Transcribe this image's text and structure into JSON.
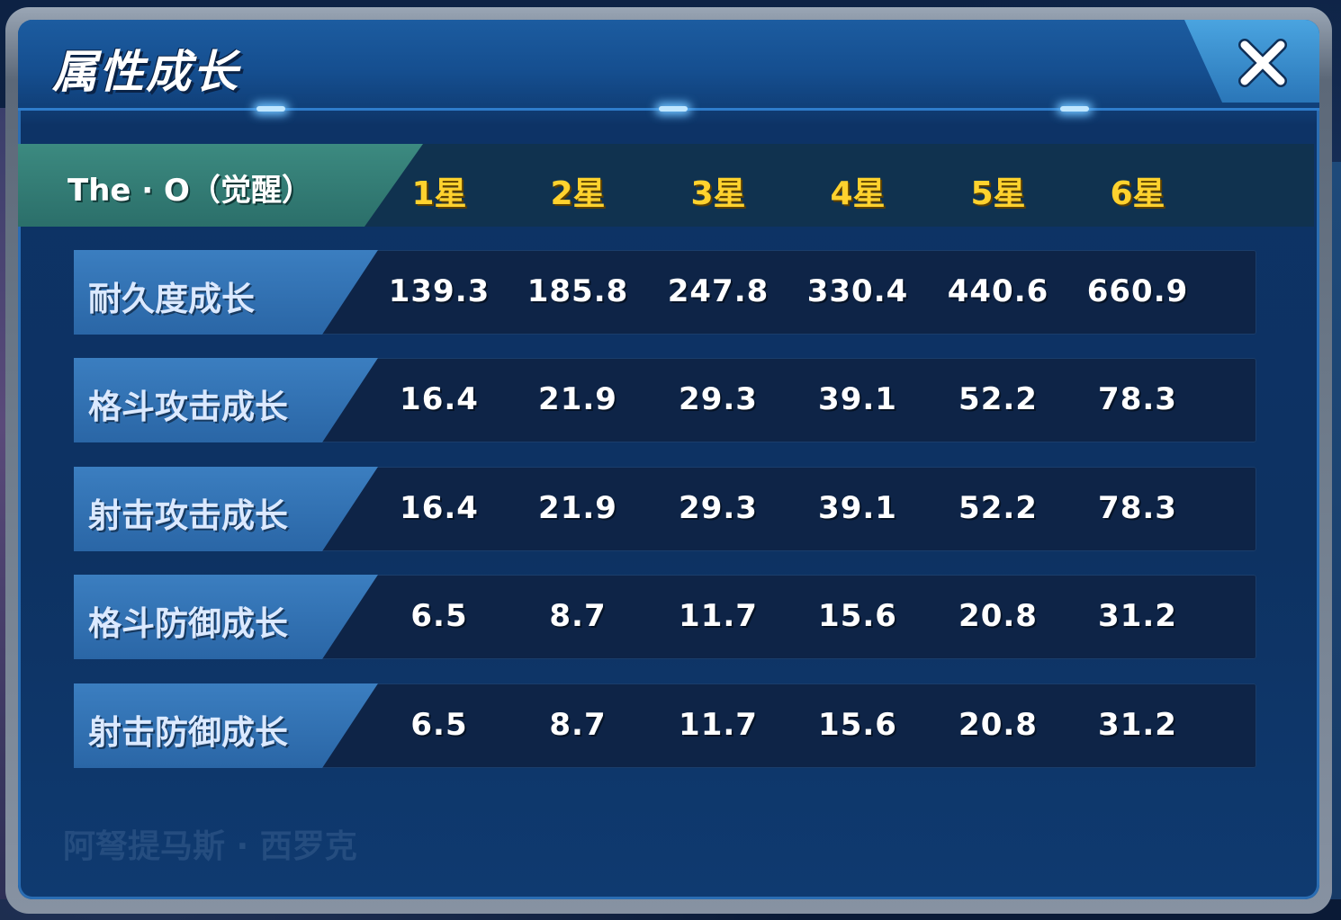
{
  "dialog": {
    "title": "属性成长",
    "close_label": "✕"
  },
  "table": {
    "unit_name": "The · O（觉醒）",
    "star_columns": [
      "1星",
      "2星",
      "3星",
      "4星",
      "5星",
      "6星"
    ],
    "rows": [
      {
        "label": "耐久度成长",
        "values": [
          "139.3",
          "185.8",
          "247.8",
          "330.4",
          "440.6",
          "660.9"
        ]
      },
      {
        "label": "格斗攻击成长",
        "values": [
          "16.4",
          "21.9",
          "29.3",
          "39.1",
          "52.2",
          "78.3"
        ]
      },
      {
        "label": "射击攻击成长",
        "values": [
          "16.4",
          "21.9",
          "29.3",
          "39.1",
          "52.2",
          "78.3"
        ]
      },
      {
        "label": "格斗防御成长",
        "values": [
          "6.5",
          "8.7",
          "11.7",
          "15.6",
          "20.8",
          "31.2"
        ]
      },
      {
        "label": "射击防御成长",
        "values": [
          "6.5",
          "8.7",
          "11.7",
          "15.6",
          "20.8",
          "31.2"
        ]
      }
    ]
  },
  "colors": {
    "star_text": "#ffd22e",
    "header_name_bg": "#3c8a80",
    "row_label_bg": "#3b7ec0",
    "panel_bg": "#0d3262"
  },
  "icons": {
    "close": "close-icon"
  }
}
